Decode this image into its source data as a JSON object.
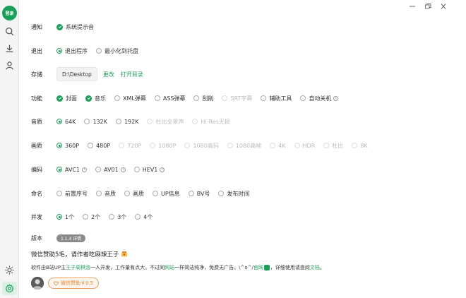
{
  "sidebar": {
    "login_label": "登录"
  },
  "settings": {
    "notify": {
      "label": "通知",
      "options": [
        {
          "text": "系统提示音"
        }
      ]
    },
    "exit": {
      "label": "退出",
      "options": [
        {
          "text": "退出程序"
        },
        {
          "text": "最小化到托盘"
        }
      ]
    },
    "storage": {
      "label": "存储",
      "path": "D:\\Desktop",
      "change": "更改",
      "open": "打开目录"
    },
    "features": {
      "label": "功能",
      "options": [
        {
          "text": "封面"
        },
        {
          "text": "音乐"
        },
        {
          "text": "XML弹幕"
        },
        {
          "text": "ASS弹幕"
        },
        {
          "text": "刮削"
        },
        {
          "text": "SRT字幕"
        },
        {
          "text": "辅助工具"
        },
        {
          "text": "自动关机"
        }
      ]
    },
    "audio": {
      "label": "音质",
      "options": [
        {
          "text": "64K"
        },
        {
          "text": "132K"
        },
        {
          "text": "192K"
        },
        {
          "text": "杜比全景声"
        },
        {
          "text": "Hi-Res无损"
        }
      ]
    },
    "video": {
      "label": "画质",
      "options": [
        {
          "text": "360P"
        },
        {
          "text": "480P"
        },
        {
          "text": "720P"
        },
        {
          "text": "1080P"
        },
        {
          "text": "1080高码"
        },
        {
          "text": "1080高帧"
        },
        {
          "text": "4K"
        },
        {
          "text": "HDR"
        },
        {
          "text": "杜比"
        },
        {
          "text": "8K"
        }
      ]
    },
    "codec": {
      "label": "编码",
      "options": [
        {
          "text": "AVC1"
        },
        {
          "text": "AV01"
        },
        {
          "text": "HEV1"
        }
      ]
    },
    "naming": {
      "label": "命名",
      "options": [
        {
          "text": "前置序号"
        },
        {
          "text": "音质"
        },
        {
          "text": "画质"
        },
        {
          "text": "UP信息"
        },
        {
          "text": "BV号"
        },
        {
          "text": "发布时间"
        }
      ]
    },
    "concurrency": {
      "label": "并发",
      "options": [
        {
          "text": "1个"
        },
        {
          "text": "2个"
        },
        {
          "text": "3个"
        },
        {
          "text": "4个"
        }
      ]
    },
    "version": {
      "label": "版本",
      "badge": "1.1.4 详情"
    }
  },
  "footer": {
    "sponsor_title": "微信赞助5毛，请作者吃麻辣王子",
    "notice": {
      "p1": "软件由B站UP主",
      "author": "王子周棋洛",
      "p2": "一人开发，工作量有点大，不过同",
      "site": "网站",
      "p3": "一样简洁纯净，免费无广告。\\^o^/",
      "official": "官网",
      "p4": "，详细使用请查阅",
      "docs": "文档",
      "p5": "。"
    },
    "sponsor_button": "微信赞助￥0.5"
  },
  "colors": {
    "accent": "#18a058",
    "sponsor": "#e8832f"
  }
}
